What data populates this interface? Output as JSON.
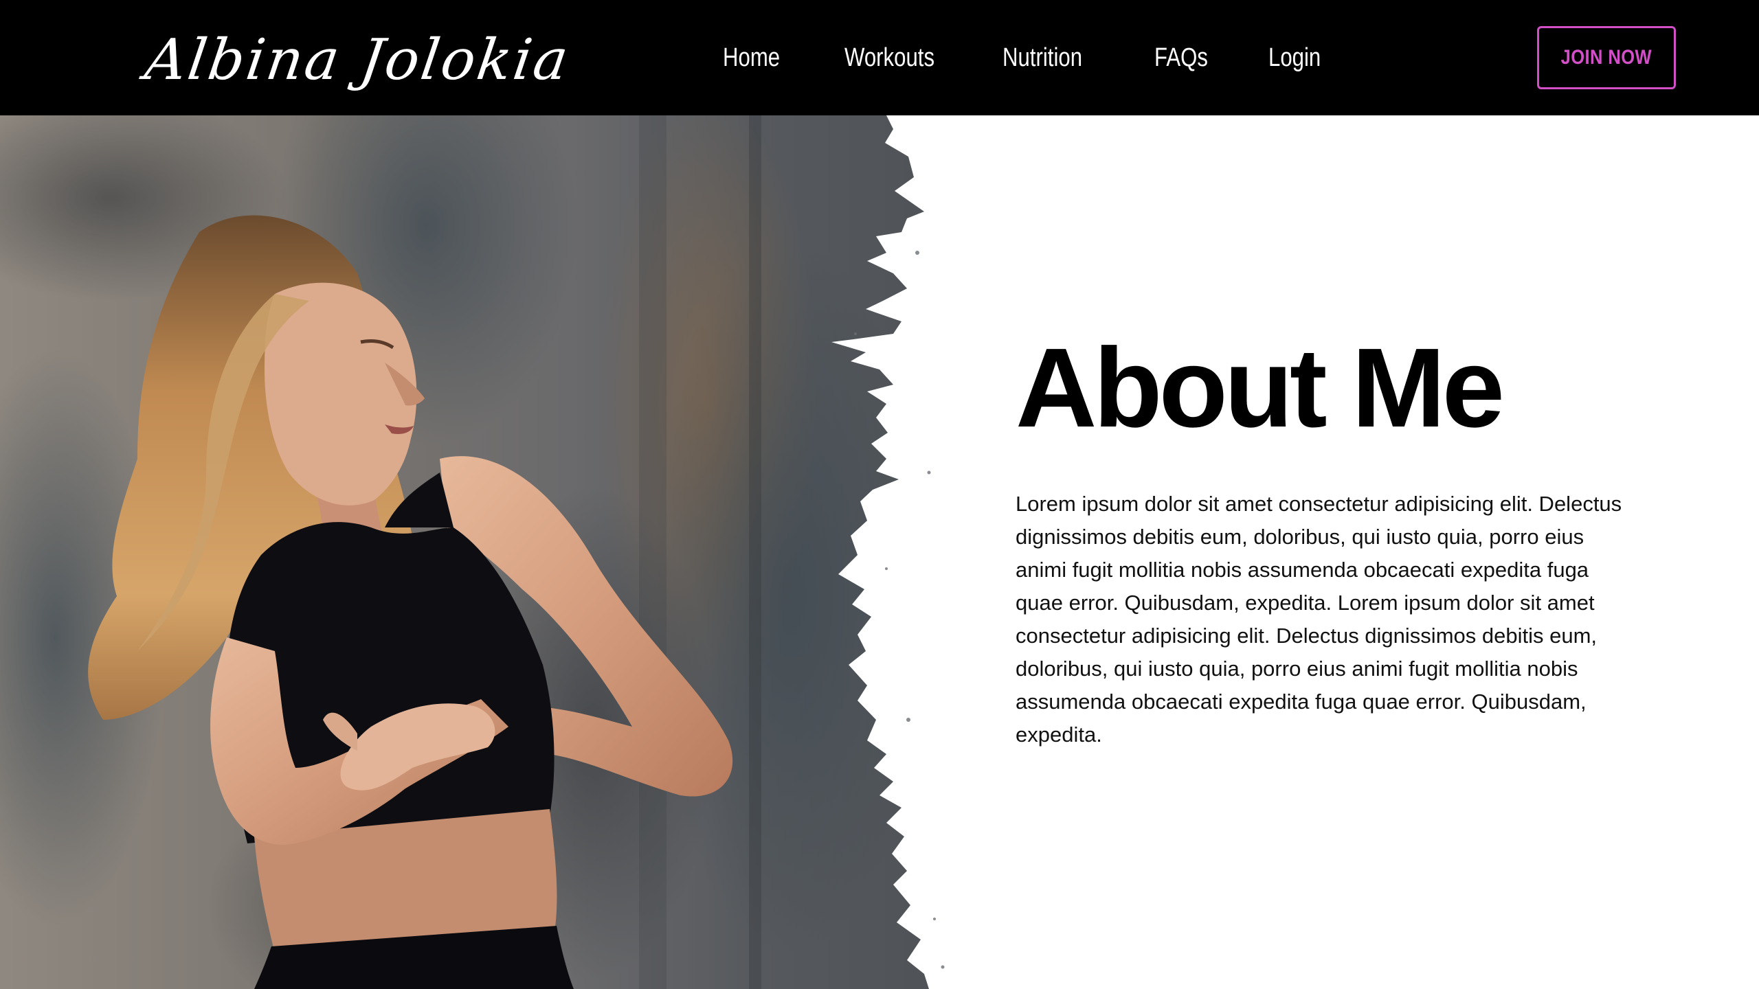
{
  "brand": {
    "logo_text": "Albina Jolokia"
  },
  "nav": {
    "items": [
      {
        "label": "Home"
      },
      {
        "label": "Workouts"
      },
      {
        "label": "Nutrition"
      },
      {
        "label": "FAQs"
      },
      {
        "label": "Login"
      }
    ],
    "cta_label": "JOIN NOW"
  },
  "about": {
    "title": "About Me",
    "body": "Lorem ipsum dolor sit amet consectetur adipisicing elit. Delectus dignissimos debitis eum, doloribus, qui iusto quia, porro eius animi fugit mollitia nobis assumenda obcaecati expedita fuga quae error. Quibusdam, expedita. Lorem ipsum dolor sit amet consectetur adipisicing elit. Delectus dignissimos debitis eum, doloribus, qui iusto quia, porro eius animi fugit mollitia nobis assumenda obcaecati expedita fuga quae error. Quibusdam, expedita."
  },
  "colors": {
    "nav_background": "#000000",
    "accent": "#d24fc8",
    "page_background": "#ffffff",
    "text": "#111111"
  }
}
